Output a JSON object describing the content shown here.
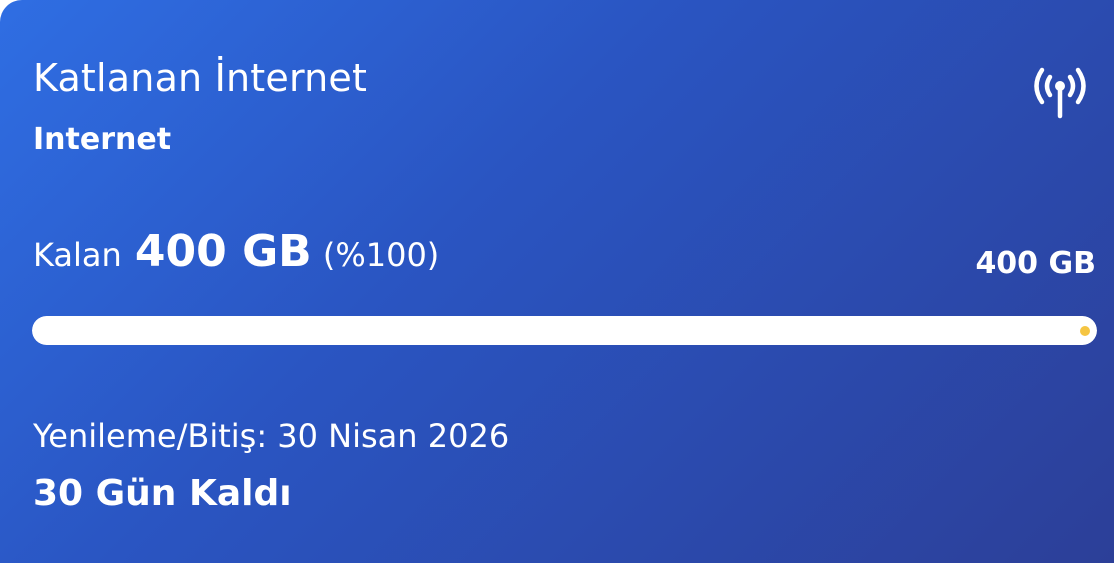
{
  "card": {
    "title": "Katlanan İnternet",
    "subtitle": "Internet",
    "icon": "antenna-signal-icon"
  },
  "usage": {
    "remaining_label": "Kalan",
    "remaining_value": "400 GB",
    "remaining_percent": "(%100)",
    "total": "400 GB",
    "progress_fraction": 1.0
  },
  "validity": {
    "renewal_text": "Yenileme/Bitiş: 30 Nisan 2026",
    "days_left": "30 Gün Kaldı"
  },
  "colors": {
    "accent_dot": "#f5c542",
    "gradient_start": "#2f6ee3",
    "gradient_end": "#2c3f98"
  }
}
